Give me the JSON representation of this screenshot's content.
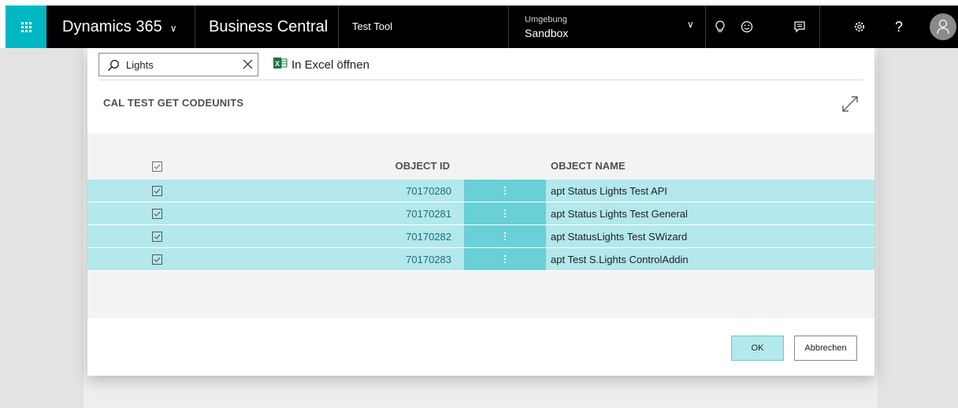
{
  "header": {
    "brand": "Dynamics 365",
    "product": "Business Central",
    "company": "Test Tool",
    "environment_label": "Umgebung",
    "environment_value": "Sandbox",
    "icons": [
      "lightbulb-icon",
      "smiley-icon",
      "chat-icon",
      "gear-icon",
      "help-icon",
      "avatar-icon"
    ],
    "accent": "#00b7c3"
  },
  "toolbar": {
    "search_value": "Lights",
    "excel_label": "In Excel öffnen"
  },
  "dialog": {
    "title": "CAL TEST GET CODEUNITS",
    "columns": {
      "id": "OBJECT ID",
      "name": "OBJECT NAME"
    },
    "rows": [
      {
        "id": "70170280",
        "name": "apt Status Lights Test API",
        "checked": true
      },
      {
        "id": "70170281",
        "name": "apt Status Lights Test General",
        "checked": true
      },
      {
        "id": "70170282",
        "name": "apt StatusLights Test SWizard",
        "checked": true
      },
      {
        "id": "70170283",
        "name": "apt Test S.Lights ControlAddin",
        "checked": true
      }
    ],
    "ok_label": "OK",
    "cancel_label": "Abbrechen",
    "selection_color": "#b3e8ec"
  }
}
